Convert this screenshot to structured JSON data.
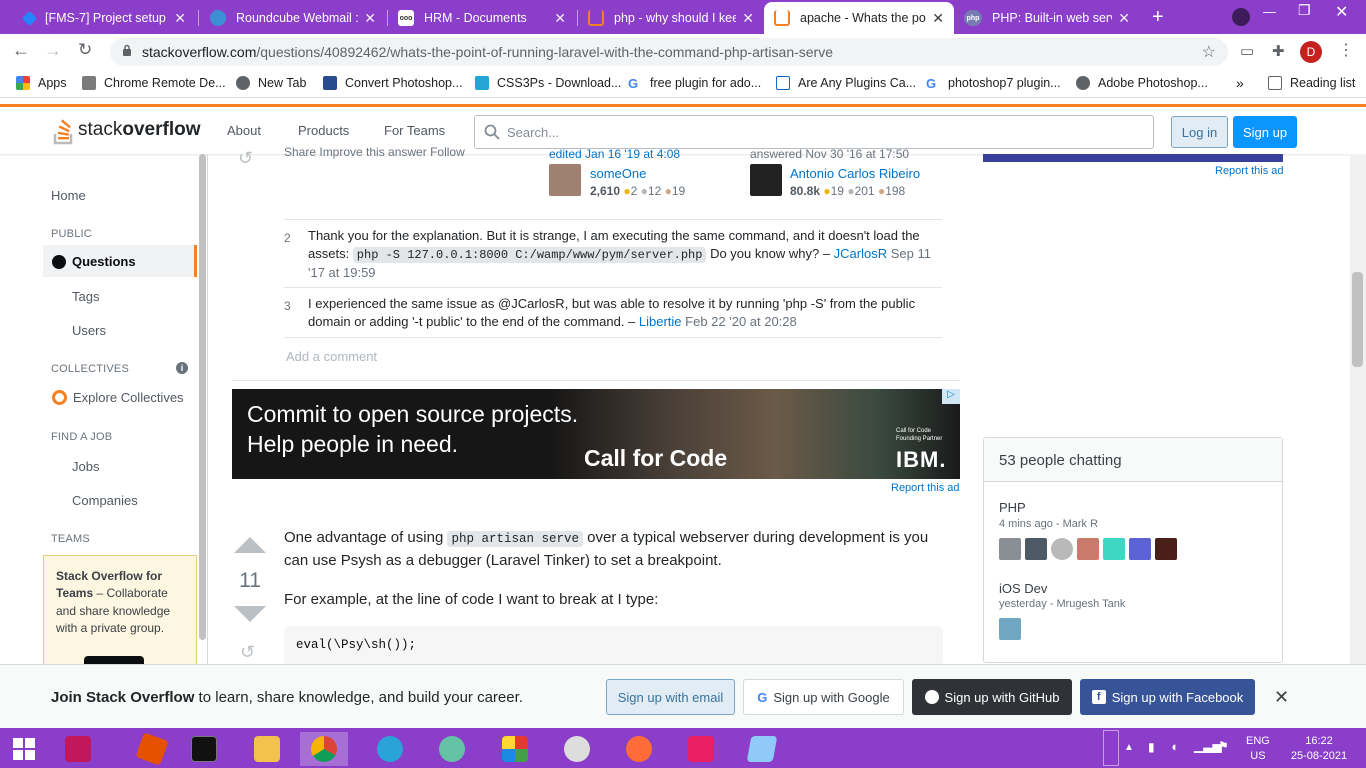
{
  "browser": {
    "tabs": [
      {
        "title": "[FMS-7] Project setup o",
        "icon": "jira-icon",
        "color": "#2684ff"
      },
      {
        "title": "Roundcube Webmail ::",
        "icon": "roundcube-icon",
        "color": "#3d8fd4"
      },
      {
        "title": "HRM - Documents",
        "icon": "hrm-icon",
        "color": "#333333"
      },
      {
        "title": "php - why should I keep",
        "icon": "stackoverflow-icon",
        "color": "#f48024"
      },
      {
        "title": "apache - Whats the poi",
        "icon": "stackoverflow-icon",
        "color": "#f48024"
      },
      {
        "title": "PHP: Built-in web serve",
        "icon": "php-icon",
        "color": "#777bb3"
      }
    ],
    "url_host": "stackoverflow.com",
    "url_path": "/questions/40892462/whats-the-point-of-running-laravel-with-the-command-php-artisan-serve",
    "profile_initial": "D",
    "bookmarks": [
      {
        "label": "Apps",
        "icon": "apps-icon"
      },
      {
        "label": "Chrome Remote De...",
        "icon": "chrome-remote-icon"
      },
      {
        "label": "New Tab",
        "icon": "globe-icon"
      },
      {
        "label": "Convert Photoshop...",
        "icon": "page-icon"
      },
      {
        "label": "CSS3Ps - Download...",
        "icon": "cube-icon"
      },
      {
        "label": "free plugin for ado...",
        "icon": "google-icon"
      },
      {
        "label": "Are Any Plugins Ca...",
        "icon": "a-icon"
      },
      {
        "label": "photoshop7 plugin...",
        "icon": "google-icon"
      },
      {
        "label": "Adobe Photoshop...",
        "icon": "globe-icon"
      }
    ],
    "more_bookmarks": "»",
    "reading_list": "Reading list"
  },
  "so_header": {
    "logo_light": "stack",
    "logo_bold": "overflow",
    "nav": [
      "About",
      "Products",
      "For Teams"
    ],
    "search_placeholder": "Search...",
    "login": "Log in",
    "signup": "Sign up"
  },
  "left_nav": {
    "home": "Home",
    "public": "PUBLIC",
    "questions": "Questions",
    "tags": "Tags",
    "users": "Users",
    "collectives": "COLLECTIVES",
    "explore_collectives": "Explore Collectives",
    "find_job": "FIND A JOB",
    "jobs": "Jobs",
    "companies": "Companies",
    "teams": "TEAMS",
    "teams_title": "Stack Overflow for Teams",
    "teams_text": " – Collaborate and share knowledge with a private group."
  },
  "post_meta": {
    "actions": "Share  Improve this answer  Follow",
    "edited": "edited Jan 16 '19 at 4:08",
    "editor": "someOne",
    "editor_rep": "2,610",
    "editor_gold": "2",
    "editor_silver": "12",
    "editor_bronze": "19",
    "answered": "answered Nov 30 '16 at 17:50",
    "author": "Antonio Carlos Ribeiro",
    "author_rep": "80.8k",
    "author_gold": "19",
    "author_silver": "201",
    "author_bronze": "198"
  },
  "comments": [
    {
      "score": "2",
      "text_a": "Thank you for the explanation. But it is strange, I am executing the same command, and it doesn't load the assets: ",
      "code": "php -S 127.0.0.1:8000 C:/wamp/www/pym/server.php",
      "text_b": " Do you know why? – ",
      "user": "JCarlosR",
      "date": " Sep 11 '17 at 19:59"
    },
    {
      "score": "3",
      "text_a": "I experienced the same issue as @JCarlosR, but was able to resolve it by running 'php -S' from the public domain or adding '-t public' to the end of the command. – ",
      "code": "",
      "text_b": "",
      "user": "Libertie",
      "date": " Feb 22 '20 at 20:28"
    }
  ],
  "add_comment": "Add a comment",
  "ad": {
    "line1": "Commit to open source projects.",
    "line2": "Help people in need.",
    "brand": "Call for Code",
    "partner": "Call for Code Founding Partner",
    "ibm": "IBM.",
    "report": "Report this ad"
  },
  "answer2": {
    "score": "11",
    "p1_a": "One advantage of using ",
    "p1_code": "php artisan serve",
    "p1_b": " over a typical webserver during development is you can use Psysh as a debugger (Laravel Tinker) to set a breakpoint.",
    "p2": "For example, at the line of code I want to break at I type:",
    "code": "eval(\\Psy\\sh());"
  },
  "sidebar": {
    "report_ad": "Report this ad",
    "chat_title": "53 people chatting",
    "rooms": [
      {
        "name": "PHP",
        "meta": "4 mins ago - Mark R"
      },
      {
        "name": "iOS Dev",
        "meta": "yesterday - Mrugesh Tank"
      }
    ]
  },
  "cookie_bar": {
    "bold": "Join Stack Overflow",
    "text": " to learn, share knowledge, and build your career.",
    "email": "Sign up with email",
    "google": "Sign up with Google",
    "github": "Sign up with GitHub",
    "facebook": "Sign up with Facebook"
  },
  "taskbar": {
    "lang1": "ENG",
    "lang2": "US",
    "time": "16:22",
    "date": "25-08-2021"
  },
  "colors": {
    "accent": "#8a3ec9",
    "so_orange": "#f48024",
    "so_blue": "#0a95ff"
  }
}
